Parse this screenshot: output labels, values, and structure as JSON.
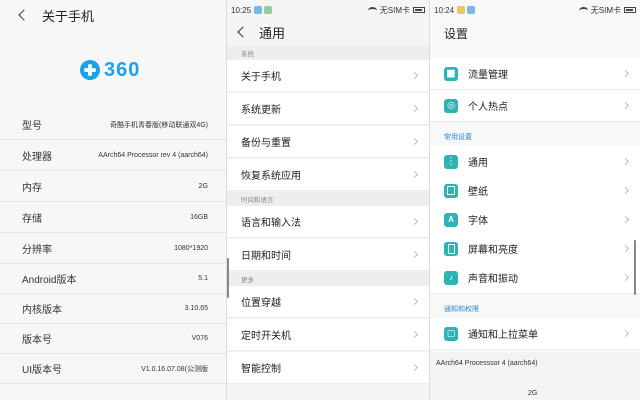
{
  "panel1": {
    "title": "关于手机",
    "logo_text": "360",
    "rows": [
      {
        "key": "型号",
        "value": "奇酷手机青春版(移动联通双4G)"
      },
      {
        "key": "处理器",
        "value": "AArch64 Processor rev 4 (aarch64)"
      },
      {
        "key": "内存",
        "value": "2G"
      },
      {
        "key": "存储",
        "value": "16GB"
      },
      {
        "key": "分辨率",
        "value": "1080*1920"
      },
      {
        "key": "Android版本",
        "value": "5.1"
      },
      {
        "key": "内核版本",
        "value": "3.10.65"
      },
      {
        "key": "版本号",
        "value": "V076"
      },
      {
        "key": "UI版本号",
        "value": "V1.0.16.07.08(公测版"
      }
    ]
  },
  "panel2": {
    "status": {
      "time": "10:25",
      "sim": "无SIM卡"
    },
    "title": "通用",
    "sections": [
      {
        "label": "系统",
        "items": [
          "关于手机",
          "系统更新",
          "备份与重置",
          "恢复系统应用"
        ]
      },
      {
        "label": "时间和语言",
        "items": [
          "语言和输入法",
          "日期和时间"
        ]
      },
      {
        "label": "更多",
        "items": [
          "位置穿越",
          "定时开关机",
          "智能控制"
        ]
      }
    ]
  },
  "panel3": {
    "status": {
      "time": "10:24",
      "sim": "无SIM卡"
    },
    "title": "设置",
    "top_items": [
      {
        "label": "流量管理",
        "icon": "chart-icon"
      },
      {
        "label": "个人热点",
        "icon": "hotspot-icon"
      }
    ],
    "common_section": "常用设置",
    "common_items": [
      {
        "label": "通用",
        "icon": "general-icon"
      },
      {
        "label": "壁纸",
        "icon": "wallpaper-icon"
      },
      {
        "label": "字体",
        "icon": "font-icon"
      },
      {
        "label": "屏幕和亮度",
        "icon": "screen-icon"
      },
      {
        "label": "声音和振动",
        "icon": "sound-icon"
      }
    ],
    "notify_section": "通知和权限",
    "notify_items": [
      {
        "label": "通知和上拉菜单",
        "icon": "notification-icon"
      }
    ],
    "bottom_line1": "AArch64 Processsor 4 (aarch64)",
    "bottom_line2": "2G"
  },
  "colors": {
    "accent": "#2f86e0",
    "icon_teal": "#2db3b3",
    "logo_blue": "#1aa3e8"
  }
}
